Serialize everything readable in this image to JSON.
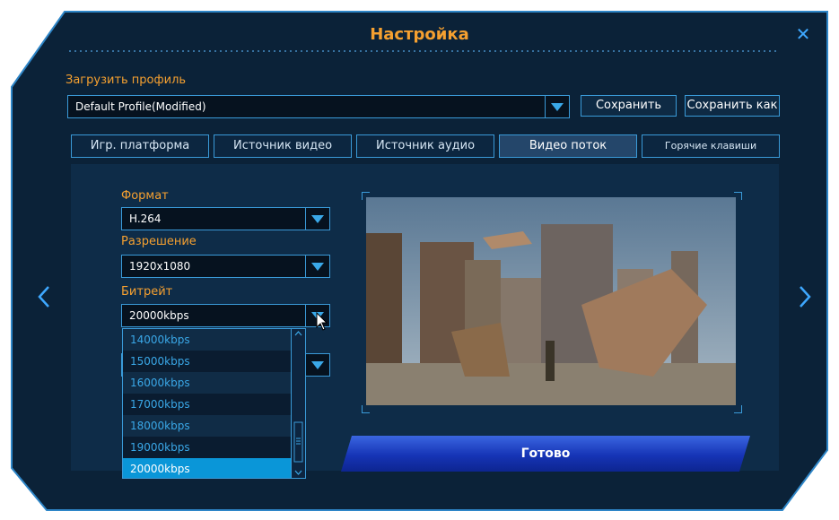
{
  "window": {
    "title": "Настройка"
  },
  "profile": {
    "label": "Загрузить профиль",
    "value": "Default Profile(Modified)",
    "save": "Сохранить",
    "save_as": "Сохранить как"
  },
  "tabs": [
    {
      "label": "Игр. платформа"
    },
    {
      "label": "Источник видео"
    },
    {
      "label": "Источник аудио"
    },
    {
      "label": "Видео поток"
    },
    {
      "label": "Горячие клавиши"
    }
  ],
  "form": {
    "format_label": "Формат",
    "format_value": "H.264",
    "resolution_label": "Разрешение",
    "resolution_value": "1920x1080",
    "bitrate_label": "Битрейт",
    "bitrate_value": "20000kbps"
  },
  "bitrate_options": [
    "14000kbps",
    "15000kbps",
    "16000kbps",
    "17000kbps",
    "18000kbps",
    "19000kbps",
    "20000kbps"
  ],
  "done": "Готово",
  "colors": {
    "accent": "#f5a030",
    "border": "#3a9ad8",
    "selected": "#0a96d8",
    "background": "#0b2238"
  }
}
